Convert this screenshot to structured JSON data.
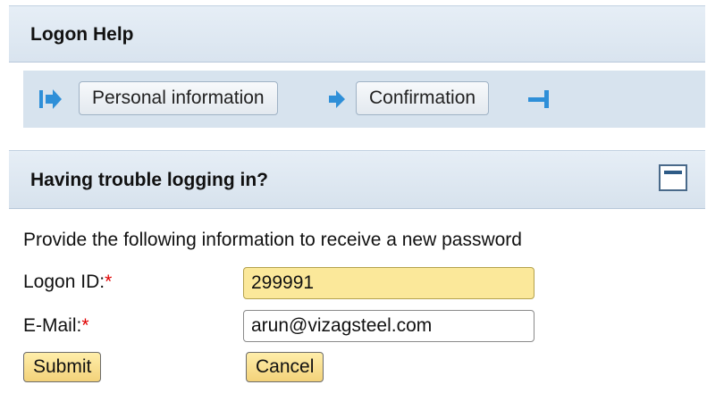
{
  "header": {
    "title": "Logon Help"
  },
  "roadmap": {
    "steps": [
      {
        "label": "Personal information"
      },
      {
        "label": "Confirmation"
      }
    ]
  },
  "section": {
    "title": "Having trouble logging in?",
    "intro": "Provide the following information to receive a new password"
  },
  "form": {
    "logon_id": {
      "label": "Logon ID:",
      "value": "299991"
    },
    "email": {
      "label": "E-Mail:",
      "value": "arun@vizagsteel.com"
    },
    "required_marker": "*"
  },
  "buttons": {
    "submit": "Submit",
    "cancel": "Cancel"
  },
  "colors": {
    "accent": "#2e8fd8",
    "required": "#e00000",
    "focus_field": "#fbe89a",
    "button": "#f3d27a"
  }
}
